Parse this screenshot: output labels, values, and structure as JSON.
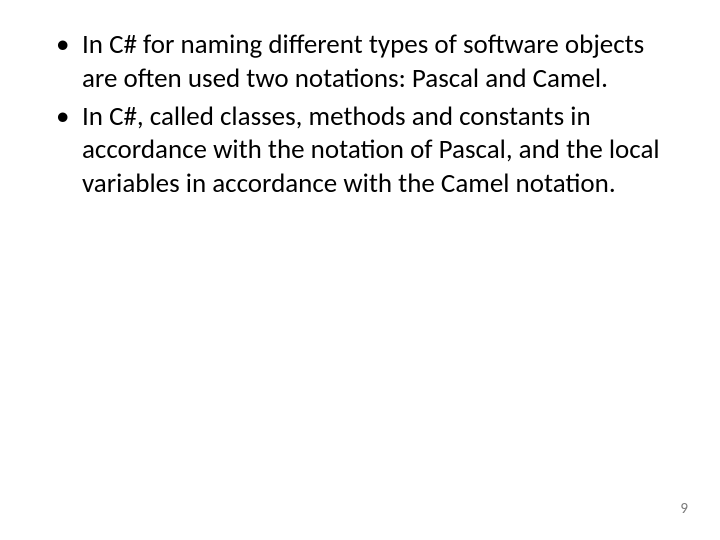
{
  "bullets": [
    "In C# for naming different types of software objects are often used two notations: Pascal and Camel.",
    "In C#, called classes, methods and constants in accordance with the notation of Pascal, and the local variables in accordance with the Camel notation."
  ],
  "pageNumber": "9"
}
